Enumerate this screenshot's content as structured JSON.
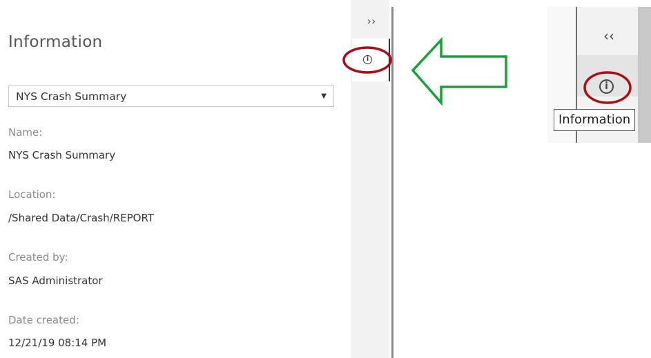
{
  "info_panel": {
    "title": "Information",
    "report_select": {
      "selected": "NYS Crash Summary",
      "arrow": "▼"
    },
    "fields": [
      {
        "label": "Name:",
        "value": "NYS Crash Summary"
      },
      {
        "label": "Location:",
        "value": "/Shared Data/Crash/REPORT"
      },
      {
        "label": "Created by:",
        "value": "SAS Administrator"
      },
      {
        "label": "Date created:",
        "value": "12/21/19 08:14 PM"
      }
    ]
  },
  "side_bar": {
    "expand_glyph": "››",
    "info_icon": "information-icon",
    "info_glyph": "i"
  },
  "inset": {
    "collapse_glyph": "‹‹",
    "info_icon": "information-icon",
    "info_glyph": "i",
    "tooltip": "Information"
  },
  "annotations": {
    "highlight_color": "#a50f15",
    "arrow_color": "#1aa03a"
  }
}
